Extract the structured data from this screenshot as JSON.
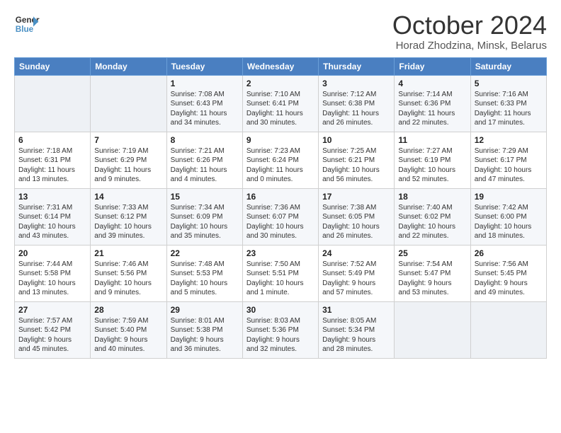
{
  "header": {
    "logo_line1": "General",
    "logo_line2": "Blue",
    "month": "October 2024",
    "location": "Horad Zhodzina, Minsk, Belarus"
  },
  "weekdays": [
    "Sunday",
    "Monday",
    "Tuesday",
    "Wednesday",
    "Thursday",
    "Friday",
    "Saturday"
  ],
  "weeks": [
    [
      {
        "day": "",
        "info": ""
      },
      {
        "day": "",
        "info": ""
      },
      {
        "day": "1",
        "info": "Sunrise: 7:08 AM\nSunset: 6:43 PM\nDaylight: 11 hours\nand 34 minutes."
      },
      {
        "day": "2",
        "info": "Sunrise: 7:10 AM\nSunset: 6:41 PM\nDaylight: 11 hours\nand 30 minutes."
      },
      {
        "day": "3",
        "info": "Sunrise: 7:12 AM\nSunset: 6:38 PM\nDaylight: 11 hours\nand 26 minutes."
      },
      {
        "day": "4",
        "info": "Sunrise: 7:14 AM\nSunset: 6:36 PM\nDaylight: 11 hours\nand 22 minutes."
      },
      {
        "day": "5",
        "info": "Sunrise: 7:16 AM\nSunset: 6:33 PM\nDaylight: 11 hours\nand 17 minutes."
      }
    ],
    [
      {
        "day": "6",
        "info": "Sunrise: 7:18 AM\nSunset: 6:31 PM\nDaylight: 11 hours\nand 13 minutes."
      },
      {
        "day": "7",
        "info": "Sunrise: 7:19 AM\nSunset: 6:29 PM\nDaylight: 11 hours\nand 9 minutes."
      },
      {
        "day": "8",
        "info": "Sunrise: 7:21 AM\nSunset: 6:26 PM\nDaylight: 11 hours\nand 4 minutes."
      },
      {
        "day": "9",
        "info": "Sunrise: 7:23 AM\nSunset: 6:24 PM\nDaylight: 11 hours\nand 0 minutes."
      },
      {
        "day": "10",
        "info": "Sunrise: 7:25 AM\nSunset: 6:21 PM\nDaylight: 10 hours\nand 56 minutes."
      },
      {
        "day": "11",
        "info": "Sunrise: 7:27 AM\nSunset: 6:19 PM\nDaylight: 10 hours\nand 52 minutes."
      },
      {
        "day": "12",
        "info": "Sunrise: 7:29 AM\nSunset: 6:17 PM\nDaylight: 10 hours\nand 47 minutes."
      }
    ],
    [
      {
        "day": "13",
        "info": "Sunrise: 7:31 AM\nSunset: 6:14 PM\nDaylight: 10 hours\nand 43 minutes."
      },
      {
        "day": "14",
        "info": "Sunrise: 7:33 AM\nSunset: 6:12 PM\nDaylight: 10 hours\nand 39 minutes."
      },
      {
        "day": "15",
        "info": "Sunrise: 7:34 AM\nSunset: 6:09 PM\nDaylight: 10 hours\nand 35 minutes."
      },
      {
        "day": "16",
        "info": "Sunrise: 7:36 AM\nSunset: 6:07 PM\nDaylight: 10 hours\nand 30 minutes."
      },
      {
        "day": "17",
        "info": "Sunrise: 7:38 AM\nSunset: 6:05 PM\nDaylight: 10 hours\nand 26 minutes."
      },
      {
        "day": "18",
        "info": "Sunrise: 7:40 AM\nSunset: 6:02 PM\nDaylight: 10 hours\nand 22 minutes."
      },
      {
        "day": "19",
        "info": "Sunrise: 7:42 AM\nSunset: 6:00 PM\nDaylight: 10 hours\nand 18 minutes."
      }
    ],
    [
      {
        "day": "20",
        "info": "Sunrise: 7:44 AM\nSunset: 5:58 PM\nDaylight: 10 hours\nand 13 minutes."
      },
      {
        "day": "21",
        "info": "Sunrise: 7:46 AM\nSunset: 5:56 PM\nDaylight: 10 hours\nand 9 minutes."
      },
      {
        "day": "22",
        "info": "Sunrise: 7:48 AM\nSunset: 5:53 PM\nDaylight: 10 hours\nand 5 minutes."
      },
      {
        "day": "23",
        "info": "Sunrise: 7:50 AM\nSunset: 5:51 PM\nDaylight: 10 hours\nand 1 minute."
      },
      {
        "day": "24",
        "info": "Sunrise: 7:52 AM\nSunset: 5:49 PM\nDaylight: 9 hours\nand 57 minutes."
      },
      {
        "day": "25",
        "info": "Sunrise: 7:54 AM\nSunset: 5:47 PM\nDaylight: 9 hours\nand 53 minutes."
      },
      {
        "day": "26",
        "info": "Sunrise: 7:56 AM\nSunset: 5:45 PM\nDaylight: 9 hours\nand 49 minutes."
      }
    ],
    [
      {
        "day": "27",
        "info": "Sunrise: 7:57 AM\nSunset: 5:42 PM\nDaylight: 9 hours\nand 45 minutes."
      },
      {
        "day": "28",
        "info": "Sunrise: 7:59 AM\nSunset: 5:40 PM\nDaylight: 9 hours\nand 40 minutes."
      },
      {
        "day": "29",
        "info": "Sunrise: 8:01 AM\nSunset: 5:38 PM\nDaylight: 9 hours\nand 36 minutes."
      },
      {
        "day": "30",
        "info": "Sunrise: 8:03 AM\nSunset: 5:36 PM\nDaylight: 9 hours\nand 32 minutes."
      },
      {
        "day": "31",
        "info": "Sunrise: 8:05 AM\nSunset: 5:34 PM\nDaylight: 9 hours\nand 28 minutes."
      },
      {
        "day": "",
        "info": ""
      },
      {
        "day": "",
        "info": ""
      }
    ]
  ]
}
